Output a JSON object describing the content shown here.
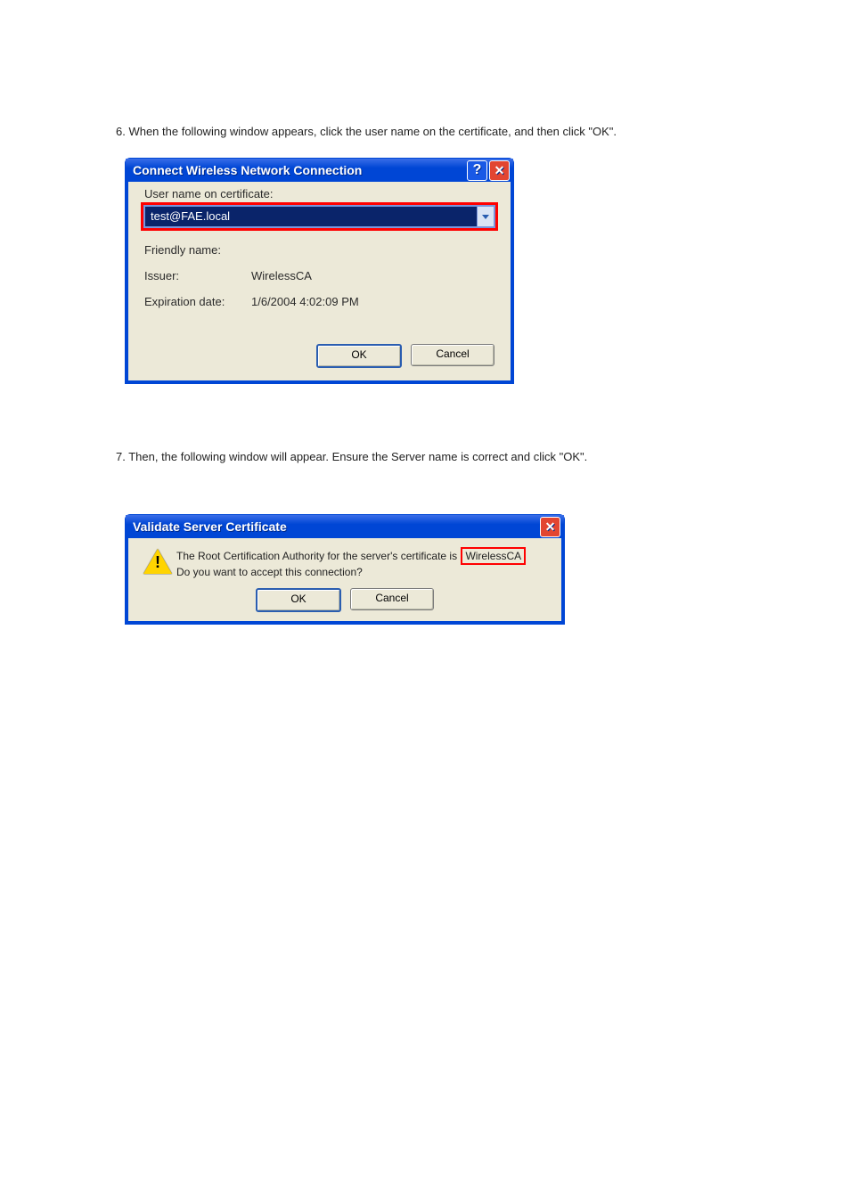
{
  "caption_top": "6. When the following window appears, click the user name on the certificate, and then click \"OK\".",
  "caption_mid": "7. Then, the following window will appear. Ensure the Server name is correct and click \"OK\".",
  "dlg1": {
    "title": "Connect Wireless Network Connection",
    "user_label": "User name on certificate:",
    "user_value": "test@FAE.local",
    "friendly_label": "Friendly name:",
    "friendly_value": "",
    "issuer_label": "Issuer:",
    "issuer_value": "WirelessCA",
    "expire_label": "Expiration date:",
    "expire_value": "1/6/2004 4:02:09 PM",
    "ok": "OK",
    "cancel": "Cancel"
  },
  "dlg2": {
    "title": "Validate Server Certificate",
    "msg_p1": "The Root Certification Authority for the server's certificate is",
    "ca": "WirelessCA",
    "msg_p2": "Do you want to accept this connection?",
    "ok": "OK",
    "cancel": "Cancel"
  }
}
